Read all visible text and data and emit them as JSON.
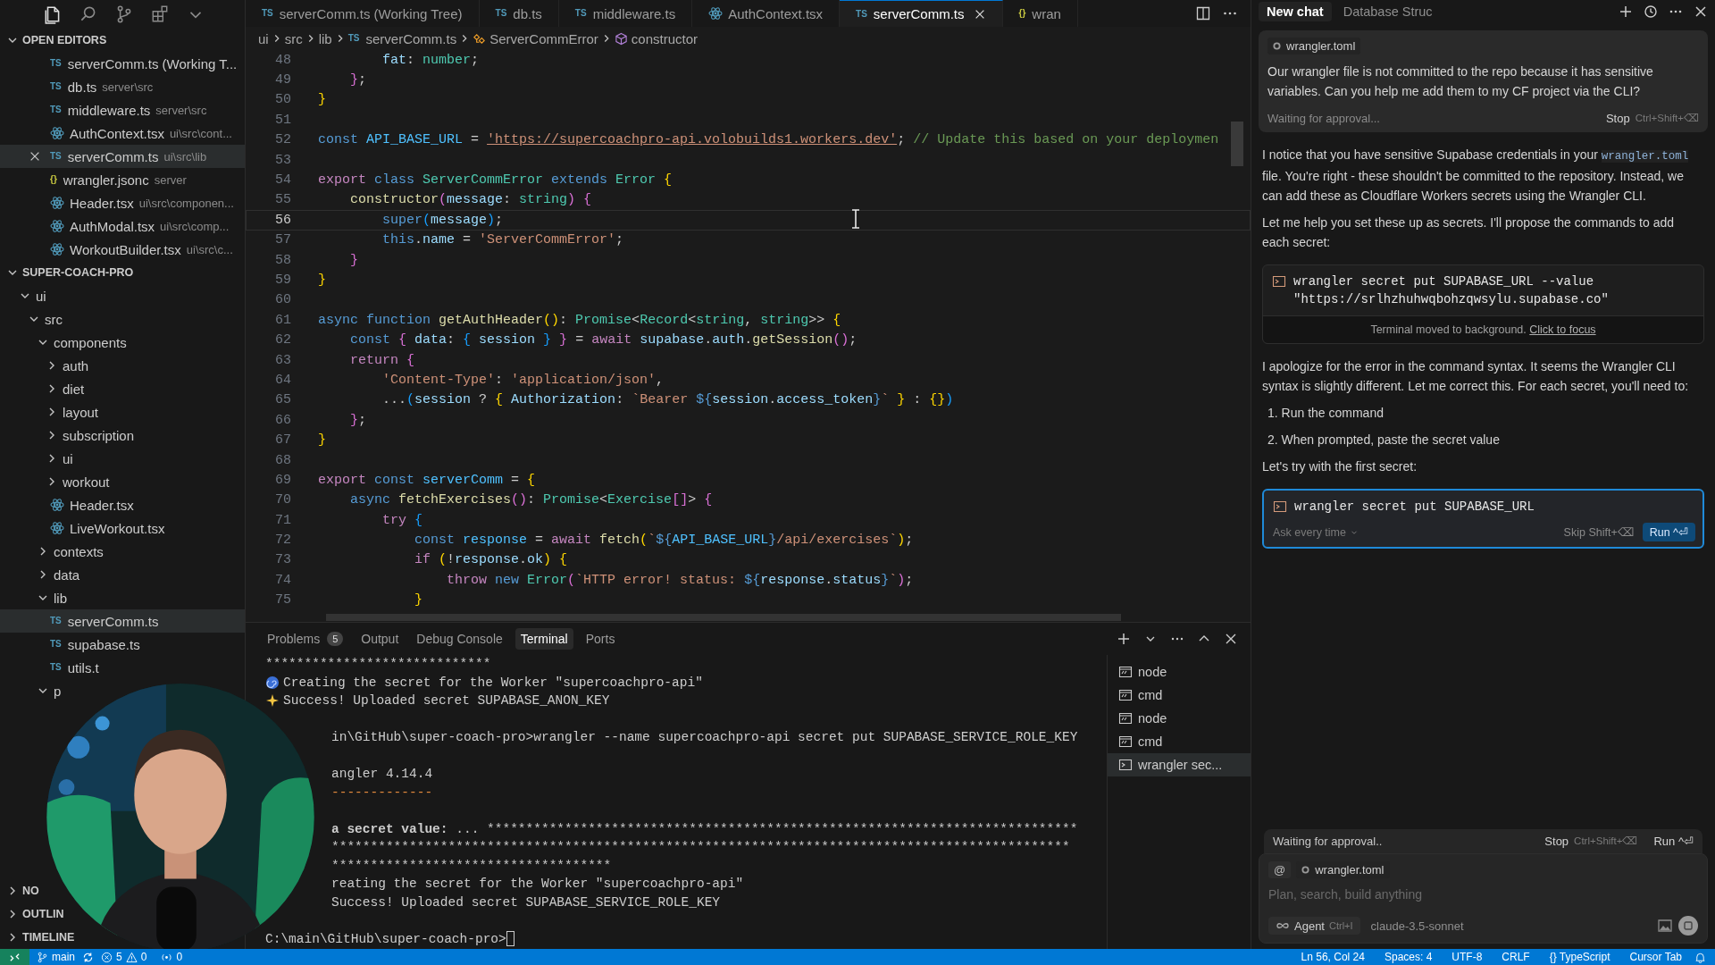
{
  "activity_icons": [
    {
      "kind": "files",
      "selected": true
    },
    {
      "kind": "search",
      "selected": false
    },
    {
      "kind": "source-control",
      "selected": false
    },
    {
      "kind": "extensions",
      "selected": false
    },
    {
      "kind": "more",
      "selected": false
    }
  ],
  "open_editors": {
    "title": "OPEN EDITORS",
    "expanded": true,
    "items": [
      {
        "label": "serverComm.ts (Working T...",
        "kind": "ts",
        "badge": "TS",
        "selected": false
      },
      {
        "label": "db.ts",
        "path": "server\\src",
        "kind": "ts",
        "badge": "TS",
        "selected": false
      },
      {
        "label": "middleware.ts",
        "path": "server\\src",
        "kind": "ts",
        "badge": "TS",
        "selected": false
      },
      {
        "label": "AuthContext.tsx",
        "path": "ui\\src\\cont...",
        "kind": "react",
        "selected": false
      },
      {
        "label": "serverComm.ts",
        "path": "ui\\src\\lib",
        "kind": "ts",
        "badge": "TS",
        "selected": true
      },
      {
        "label": "wrangler.jsonc",
        "path": "server",
        "kind": "json",
        "badge": "{}",
        "selected": false
      },
      {
        "label": "Header.tsx",
        "path": "ui\\src\\componen...",
        "kind": "react",
        "selected": false
      },
      {
        "label": "AuthModal.tsx",
        "path": "ui\\src\\comp...",
        "kind": "react",
        "selected": false
      },
      {
        "label": "WorkoutBuilder.tsx",
        "path": "ui\\src\\c...",
        "kind": "react",
        "selected": false
      }
    ]
  },
  "explorer": {
    "title": "SUPER-COACH-PRO",
    "expanded": true,
    "tree": [
      {
        "label": "ui",
        "kind": "folder",
        "expanded": true,
        "selected": false,
        "children": [
          {
            "label": "src",
            "kind": "folder",
            "expanded": true,
            "selected": false,
            "children": [
              {
                "label": "components",
                "kind": "folder",
                "expanded": true,
                "selected": false,
                "children": [
                  {
                    "label": "auth",
                    "kind": "folder",
                    "expanded": false,
                    "selected": false
                  },
                  {
                    "label": "diet",
                    "kind": "folder",
                    "expanded": false,
                    "selected": false
                  },
                  {
                    "label": "layout",
                    "kind": "folder",
                    "expanded": false,
                    "selected": false
                  },
                  {
                    "label": "subscription",
                    "kind": "folder",
                    "expanded": false,
                    "selected": false
                  },
                  {
                    "label": "ui",
                    "kind": "folder",
                    "expanded": false,
                    "selected": false
                  },
                  {
                    "label": "workout",
                    "kind": "folder",
                    "expanded": false,
                    "selected": false
                  },
                  {
                    "label": "Header.tsx",
                    "kind": "react",
                    "selected": false
                  },
                  {
                    "label": "LiveWorkout.tsx",
                    "kind": "react",
                    "selected": false
                  }
                ]
              },
              {
                "label": "contexts",
                "kind": "folder",
                "expanded": false,
                "selected": false
              },
              {
                "label": "data",
                "kind": "folder",
                "expanded": false,
                "selected": false
              },
              {
                "label": "lib",
                "kind": "folder",
                "expanded": true,
                "selected": false,
                "children": [
                  {
                    "label": "serverComm.ts",
                    "kind": "ts",
                    "badge": "TS",
                    "selected": true
                  },
                  {
                    "label": "supabase.ts",
                    "kind": "ts",
                    "badge": "TS",
                    "selected": false
                  },
                  {
                    "label": "utils.t",
                    "kind": "ts",
                    "badge": "TS",
                    "selected": false
                  }
                ]
              },
              {
                "label": "p",
                "kind": "folder",
                "expanded": true,
                "selected": false
              }
            ]
          }
        ]
      }
    ]
  },
  "collapsed_sections": [
    {
      "title": "NO",
      "expanded": false
    },
    {
      "title": "OUTLIN",
      "expanded": false
    },
    {
      "title": "TIMELINE",
      "expanded": false
    }
  ],
  "editor_tabs": [
    {
      "label": "serverComm.ts (Working Tree)",
      "kind": "ts",
      "badge": "TS",
      "selected": false
    },
    {
      "label": "db.ts",
      "kind": "ts",
      "badge": "TS",
      "selected": false
    },
    {
      "label": "middleware.ts",
      "kind": "ts",
      "badge": "TS",
      "selected": false
    },
    {
      "label": "AuthContext.tsx",
      "kind": "react",
      "selected": false
    },
    {
      "label": "serverComm.ts",
      "kind": "ts",
      "badge": "TS",
      "selected": true
    },
    {
      "label": "wran",
      "kind": "json",
      "badge": "{}",
      "selected": false
    }
  ],
  "breadcrumb": [
    {
      "label": "ui",
      "kind": "folder"
    },
    {
      "label": "src",
      "kind": "folder"
    },
    {
      "label": "lib",
      "kind": "folder"
    },
    {
      "label": "serverComm.ts",
      "kind": "ts",
      "badge": "TS"
    },
    {
      "label": "ServerCommError",
      "kind": "class"
    },
    {
      "label": "constructor",
      "kind": "method"
    }
  ],
  "code": {
    "lines": [
      {
        "n": "48",
        "current": false,
        "tokens": [
          {
            "kind": "var",
            "text": "        fat"
          },
          {
            "kind": "p",
            "text": ": "
          },
          {
            "kind": "typ",
            "text": "number"
          },
          {
            "kind": "p",
            "text": ";"
          }
        ]
      },
      {
        "n": "49",
        "current": false,
        "tokens": [
          {
            "kind": "b2",
            "text": "    }"
          },
          {
            "kind": "p",
            "text": ";"
          }
        ]
      },
      {
        "n": "50",
        "current": false,
        "tokens": [
          {
            "kind": "b1",
            "text": "}"
          }
        ]
      },
      {
        "n": "51",
        "current": false
      },
      {
        "n": "52",
        "current": false,
        "tokens": [
          {
            "kind": "kw",
            "text": "const "
          },
          {
            "kind": "cst",
            "text": "API_BASE_URL"
          },
          {
            "kind": "p",
            "text": " = "
          },
          {
            "kind": "url",
            "text": "'https://supercoachpro-api.volobuilds1.workers.dev'"
          },
          {
            "kind": "p",
            "text": "; "
          },
          {
            "kind": "cmt",
            "text": "// Update this based on your deploymen"
          }
        ]
      },
      {
        "n": "53",
        "current": false
      },
      {
        "n": "54",
        "current": false,
        "tokens": [
          {
            "kind": "ctl",
            "text": "export "
          },
          {
            "kind": "kw",
            "text": "class "
          },
          {
            "kind": "cls",
            "text": "ServerCommError "
          },
          {
            "kind": "kw",
            "text": "extends "
          },
          {
            "kind": "cls",
            "text": "Error "
          },
          {
            "kind": "b1",
            "text": "{"
          }
        ]
      },
      {
        "n": "55",
        "current": false,
        "tokens": [
          {
            "kind": "fn",
            "text": "    constructor"
          },
          {
            "kind": "b2",
            "text": "("
          },
          {
            "kind": "var",
            "text": "message"
          },
          {
            "kind": "p",
            "text": ": "
          },
          {
            "kind": "typ",
            "text": "string"
          },
          {
            "kind": "b2",
            "text": ") {"
          }
        ]
      },
      {
        "n": "56",
        "current": true,
        "tokens": [
          {
            "kind": "kw",
            "text": "        super"
          },
          {
            "kind": "b3",
            "text": "("
          },
          {
            "kind": "var",
            "text": "message"
          },
          {
            "kind": "b3",
            "text": ")"
          },
          {
            "kind": "p",
            "text": ";"
          }
        ]
      },
      {
        "n": "57",
        "current": false,
        "tokens": [
          {
            "kind": "kw",
            "text": "        this"
          },
          {
            "kind": "p",
            "text": "."
          },
          {
            "kind": "var",
            "text": "name"
          },
          {
            "kind": "p",
            "text": " = "
          },
          {
            "kind": "str",
            "text": "'ServerCommError'"
          },
          {
            "kind": "p",
            "text": ";"
          }
        ]
      },
      {
        "n": "58",
        "current": false,
        "tokens": [
          {
            "kind": "b2",
            "text": "    }"
          }
        ]
      },
      {
        "n": "59",
        "current": false,
        "tokens": [
          {
            "kind": "b1",
            "text": "}"
          }
        ]
      },
      {
        "n": "60",
        "current": false
      },
      {
        "n": "61",
        "current": false,
        "tokens": [
          {
            "kind": "kw",
            "text": "async function "
          },
          {
            "kind": "fn",
            "text": "getAuthHeader"
          },
          {
            "kind": "b1",
            "text": "()"
          },
          {
            "kind": "p",
            "text": ": "
          },
          {
            "kind": "cls",
            "text": "Promise"
          },
          {
            "kind": "p",
            "text": "<"
          },
          {
            "kind": "cls",
            "text": "Record"
          },
          {
            "kind": "p",
            "text": "<"
          },
          {
            "kind": "typ",
            "text": "string"
          },
          {
            "kind": "p",
            "text": ", "
          },
          {
            "kind": "typ",
            "text": "string"
          },
          {
            "kind": "p",
            "text": ">> "
          },
          {
            "kind": "b1",
            "text": "{"
          }
        ]
      },
      {
        "n": "62",
        "current": false,
        "tokens": [
          {
            "kind": "kw",
            "text": "    const "
          },
          {
            "kind": "b2",
            "text": "{ "
          },
          {
            "kind": "var",
            "text": "data"
          },
          {
            "kind": "p",
            "text": ": "
          },
          {
            "kind": "b3",
            "text": "{ "
          },
          {
            "kind": "var",
            "text": "session "
          },
          {
            "kind": "b3",
            "text": "} "
          },
          {
            "kind": "b2",
            "text": "}"
          },
          {
            "kind": "p",
            "text": " = "
          },
          {
            "kind": "ctl",
            "text": "await "
          },
          {
            "kind": "var",
            "text": "supabase"
          },
          {
            "kind": "p",
            "text": "."
          },
          {
            "kind": "var",
            "text": "auth"
          },
          {
            "kind": "p",
            "text": "."
          },
          {
            "kind": "fn",
            "text": "getSession"
          },
          {
            "kind": "b2",
            "text": "()"
          },
          {
            "kind": "p",
            "text": ";"
          }
        ]
      },
      {
        "n": "63",
        "current": false,
        "tokens": [
          {
            "kind": "ctl",
            "text": "    return "
          },
          {
            "kind": "b2",
            "text": "{"
          }
        ]
      },
      {
        "n": "64",
        "current": false,
        "tokens": [
          {
            "kind": "str",
            "text": "        'Content-Type'"
          },
          {
            "kind": "p",
            "text": ": "
          },
          {
            "kind": "str",
            "text": "'application/json'"
          },
          {
            "kind": "p",
            "text": ","
          }
        ]
      },
      {
        "n": "65",
        "current": false,
        "tokens": [
          {
            "kind": "p",
            "text": "        ..."
          },
          {
            "kind": "b3",
            "text": "("
          },
          {
            "kind": "var",
            "text": "session"
          },
          {
            "kind": "p",
            "text": " ? "
          },
          {
            "kind": "b1",
            "text": "{ "
          },
          {
            "kind": "var",
            "text": "Authorization"
          },
          {
            "kind": "p",
            "text": ": "
          },
          {
            "kind": "str",
            "text": "`Bearer "
          },
          {
            "kind": "kw",
            "text": "${"
          },
          {
            "kind": "var",
            "text": "session"
          },
          {
            "kind": "p",
            "text": "."
          },
          {
            "kind": "var",
            "text": "access_token"
          },
          {
            "kind": "kw",
            "text": "}"
          },
          {
            "kind": "str",
            "text": "`"
          },
          {
            "kind": "b1",
            "text": " }"
          },
          {
            "kind": "p",
            "text": " : "
          },
          {
            "kind": "b1",
            "text": "{}"
          },
          {
            "kind": "b3",
            "text": ")"
          }
        ]
      },
      {
        "n": "66",
        "current": false,
        "tokens": [
          {
            "kind": "b2",
            "text": "    }"
          },
          {
            "kind": "p",
            "text": ";"
          }
        ]
      },
      {
        "n": "67",
        "current": false,
        "tokens": [
          {
            "kind": "b1",
            "text": "}"
          }
        ]
      },
      {
        "n": "68",
        "current": false
      },
      {
        "n": "69",
        "current": false,
        "tokens": [
          {
            "kind": "ctl",
            "text": "export "
          },
          {
            "kind": "kw",
            "text": "const "
          },
          {
            "kind": "cst",
            "text": "serverComm"
          },
          {
            "kind": "p",
            "text": " = "
          },
          {
            "kind": "b1",
            "text": "{"
          }
        ]
      },
      {
        "n": "70",
        "current": false,
        "tokens": [
          {
            "kind": "kw",
            "text": "    async "
          },
          {
            "kind": "fn",
            "text": "fetchExercises"
          },
          {
            "kind": "b2",
            "text": "()"
          },
          {
            "kind": "p",
            "text": ": "
          },
          {
            "kind": "cls",
            "text": "Promise"
          },
          {
            "kind": "p",
            "text": "<"
          },
          {
            "kind": "cls",
            "text": "Exercise"
          },
          {
            "kind": "b2",
            "text": "[]"
          },
          {
            "kind": "p",
            "text": "> "
          },
          {
            "kind": "b2",
            "text": "{"
          }
        ]
      },
      {
        "n": "71",
        "current": false,
        "tokens": [
          {
            "kind": "ctl",
            "text": "        try "
          },
          {
            "kind": "b3",
            "text": "{"
          }
        ]
      },
      {
        "n": "72",
        "current": false,
        "tokens": [
          {
            "kind": "kw",
            "text": "            const "
          },
          {
            "kind": "cst",
            "text": "response"
          },
          {
            "kind": "p",
            "text": " = "
          },
          {
            "kind": "ctl",
            "text": "await "
          },
          {
            "kind": "fn",
            "text": "fetch"
          },
          {
            "kind": "b1",
            "text": "("
          },
          {
            "kind": "str",
            "text": "`"
          },
          {
            "kind": "kw",
            "text": "${"
          },
          {
            "kind": "cst",
            "text": "API_BASE_URL"
          },
          {
            "kind": "kw",
            "text": "}"
          },
          {
            "kind": "str",
            "text": "/api/exercises`"
          },
          {
            "kind": "b1",
            "text": ")"
          },
          {
            "kind": "p",
            "text": ";"
          }
        ]
      },
      {
        "n": "73",
        "current": false,
        "tokens": [
          {
            "kind": "ctl",
            "text": "            if "
          },
          {
            "kind": "b1",
            "text": "("
          },
          {
            "kind": "p",
            "text": "!"
          },
          {
            "kind": "var",
            "text": "response"
          },
          {
            "kind": "p",
            "text": "."
          },
          {
            "kind": "var",
            "text": "ok"
          },
          {
            "kind": "b1",
            "text": ") {"
          }
        ]
      },
      {
        "n": "74",
        "current": false,
        "tokens": [
          {
            "kind": "ctl",
            "text": "                throw "
          },
          {
            "kind": "kw",
            "text": "new "
          },
          {
            "kind": "cls",
            "text": "Error"
          },
          {
            "kind": "b2",
            "text": "("
          },
          {
            "kind": "str",
            "text": "`HTTP error! status: "
          },
          {
            "kind": "kw",
            "text": "${"
          },
          {
            "kind": "var",
            "text": "response"
          },
          {
            "kind": "p",
            "text": "."
          },
          {
            "kind": "var",
            "text": "status"
          },
          {
            "kind": "kw",
            "text": "}"
          },
          {
            "kind": "str",
            "text": "`"
          },
          {
            "kind": "b2",
            "text": ")"
          },
          {
            "kind": "p",
            "text": ";"
          }
        ]
      },
      {
        "n": "75",
        "current": false,
        "tokens": [
          {
            "kind": "b1",
            "text": "            }"
          }
        ]
      }
    ]
  },
  "panel": {
    "tabs": [
      {
        "label": "Problems",
        "badge": "5",
        "selected": false
      },
      {
        "label": "Output",
        "selected": false
      },
      {
        "label": "Debug Console",
        "selected": false
      },
      {
        "label": "Terminal",
        "selected": true
      },
      {
        "label": "Ports",
        "selected": false
      }
    ],
    "terminal_lines": [
      {
        "kind": "output",
        "text": "*****************************"
      },
      {
        "kind": "creating",
        "text": "Creating the secret for the Worker \"supercoachpro-api\""
      },
      {
        "kind": "success",
        "text": "Success! Uploaded secret SUPABASE_ANON_KEY"
      },
      {
        "kind": "blank"
      },
      {
        "kind": "partial",
        "text": "in\\GitHub\\super-coach-pro>wrangler --name supercoachpro-api secret put SUPABASE_SERVICE_ROLE_KEY"
      },
      {
        "kind": "blank"
      },
      {
        "kind": "partial",
        "text": "angler 4.14.4"
      },
      {
        "kind": "dashes",
        "text": "-------------"
      },
      {
        "kind": "blank"
      },
      {
        "kind": "secret",
        "label": "a secret value:",
        "text": " ... ****************************************************************************"
      },
      {
        "kind": "partial",
        "text": "***********************************************************************************************"
      },
      {
        "kind": "partial",
        "text": "************************************"
      },
      {
        "kind": "partial",
        "text": "reating the secret for the Worker \"supercoachpro-api\""
      },
      {
        "kind": "partial",
        "text": "Success! Uploaded secret SUPABASE_SERVICE_ROLE_KEY"
      },
      {
        "kind": "blank"
      },
      {
        "kind": "prompt",
        "text": "C:\\main\\GitHub\\super-coach-pro>"
      }
    ],
    "terminals": [
      {
        "label": "node",
        "selected": false,
        "kind": "cmd"
      },
      {
        "label": "cmd",
        "selected": false,
        "kind": "cmd"
      },
      {
        "label": "node",
        "selected": false,
        "kind": "cmd"
      },
      {
        "label": "cmd",
        "selected": false,
        "kind": "cmd"
      },
      {
        "label": "wrangler sec...",
        "selected": true,
        "kind": "shell"
      }
    ]
  },
  "chat": {
    "tabs": [
      {
        "label": "New chat",
        "selected": true
      },
      {
        "label": "Database Struc",
        "selected": false
      }
    ],
    "user_message": {
      "file_chip": "wrangler.toml",
      "text": "Our wrangler file is not committed to the repo because it has sensitive variables. Can you help me add them to my CF project via the CLI?",
      "status": "Waiting for approval...",
      "stop_label": "Stop",
      "stop_shortcut": "Ctrl+Shift+⌫"
    },
    "messages": [
      {
        "kind": "paragraph",
        "parts": [
          {
            "kind": "text",
            "text": "I notice that you have sensitive Supabase credentials in your "
          },
          {
            "kind": "code",
            "text": "wrangler.toml"
          },
          {
            "kind": "text",
            "text": " file. You're right - these shouldn't be committed to the repository. Instead, we can add these as Cloudflare Workers secrets using the Wrangler CLI."
          }
        ]
      },
      {
        "kind": "paragraph",
        "parts": [
          {
            "kind": "text",
            "text": "Let me help you set these up as secrets. I'll propose the commands to add each secret:"
          }
        ]
      },
      {
        "kind": "command",
        "active": false,
        "command": "wrangler secret put SUPABASE_URL --value \"https://srlhzhuhwqbohzqwsylu.supabase.co\"",
        "footer": "Terminal moved to background.",
        "footer_link": "Click to focus"
      },
      {
        "kind": "paragraph",
        "parts": [
          {
            "kind": "text",
            "text": "I apologize for the error in the command syntax. It seems the Wrangler CLI syntax is slightly different. Let me correct this. For each secret, you'll need to:"
          }
        ]
      },
      {
        "kind": "list",
        "items": [
          {
            "number": "1.",
            "text": "Run the command"
          },
          {
            "number": "2.",
            "text": "When prompted, paste the secret value"
          }
        ]
      },
      {
        "kind": "paragraph",
        "parts": [
          {
            "kind": "text",
            "text": "Let's try with the first secret:"
          }
        ]
      },
      {
        "kind": "command",
        "active": true,
        "command": "wrangler secret put SUPABASE_URL",
        "mode": "Ask every time",
        "skip_label": "Skip Shift+⌫",
        "run_label": "Run ^⏎"
      }
    ],
    "composer": {
      "status": "Waiting for approval..",
      "stop_label": "Stop",
      "stop_shortcut": "Ctrl+Shift+⌫",
      "run_label": "Run ^⏎",
      "mention": "@",
      "file_chip": "wrangler.toml",
      "placeholder": "Plan, search, build anything",
      "agent_label": "Agent",
      "agent_shortcut": "Ctrl+I",
      "model": "claude-3.5-sonnet"
    }
  },
  "status_bar": {
    "branch": "main",
    "errors": "5",
    "warnings": "0",
    "ports": "0",
    "right": [
      "Ln 56, Col 24",
      "Spaces: 4",
      "UTF-8",
      "CRLF",
      "{} TypeScript",
      "Cursor Tab"
    ]
  }
}
